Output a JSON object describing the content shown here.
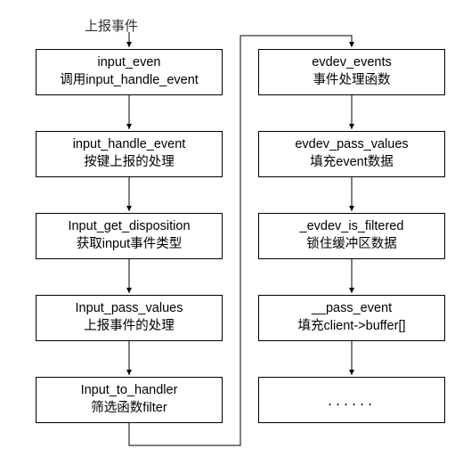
{
  "header_label": "上报事件",
  "left": [
    {
      "line1": "input_even",
      "line2": "调用input_handle_event"
    },
    {
      "line1": "input_handle_event",
      "line2": "按键上报的处理"
    },
    {
      "line1": "Input_get_disposition",
      "line2": "获取input事件类型"
    },
    {
      "line1": "Input_pass_values",
      "line2": "上报事件的处理"
    },
    {
      "line1": "Input_to_handler",
      "line2": "筛选函数filter"
    }
  ],
  "right": [
    {
      "line1": "evdev_events",
      "line2": "事件处理函数"
    },
    {
      "line1": "evdev_pass_values",
      "line2": "填充event数据"
    },
    {
      "line1": "_evdev_is_filtered",
      "line2": "锁住缓冲区数据"
    },
    {
      "line1": "__pass_event",
      "line2": "填充client->buffer[]"
    },
    {
      "line1": "......",
      "line2": ""
    }
  ]
}
